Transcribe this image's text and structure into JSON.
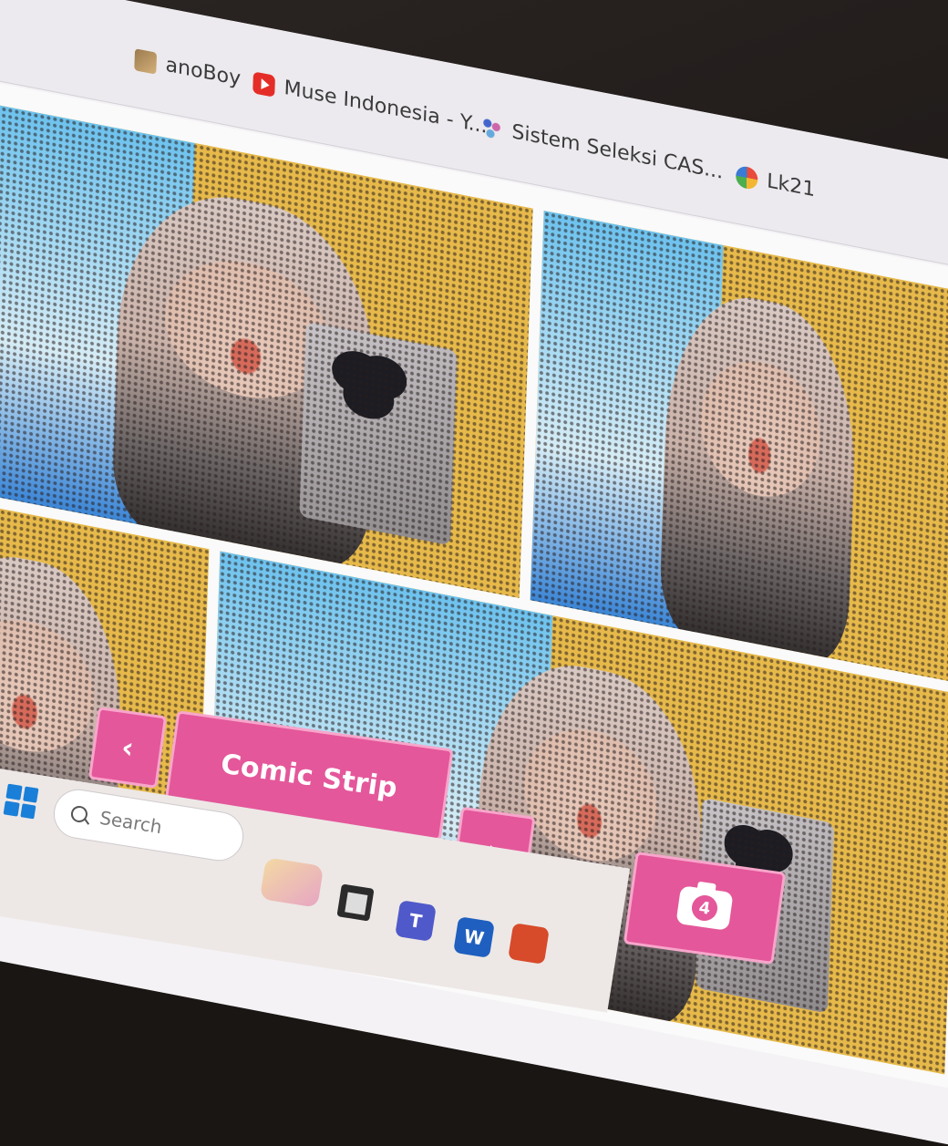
{
  "browser": {
    "bookmarks": [
      {
        "label": "anoBoy",
        "icon": "anoboy-icon"
      },
      {
        "label": "Muse Indonesia - Y...",
        "icon": "youtube-icon"
      },
      {
        "label": "Sistem Seleksi CAS...",
        "icon": "sistem-seleksi-icon"
      },
      {
        "label": "Lk21",
        "icon": "lk21-icon"
      }
    ]
  },
  "photobooth": {
    "photo_count": 4,
    "prev_label": "‹",
    "mode_label": "Comic Strip",
    "next_label": "›",
    "capture_count": "4"
  },
  "taskbar": {
    "search_placeholder": "Search",
    "teams_label": "T",
    "word_label": "W"
  },
  "colors": {
    "accent": "#e4579a",
    "accent_border": "#f7a6cb"
  }
}
